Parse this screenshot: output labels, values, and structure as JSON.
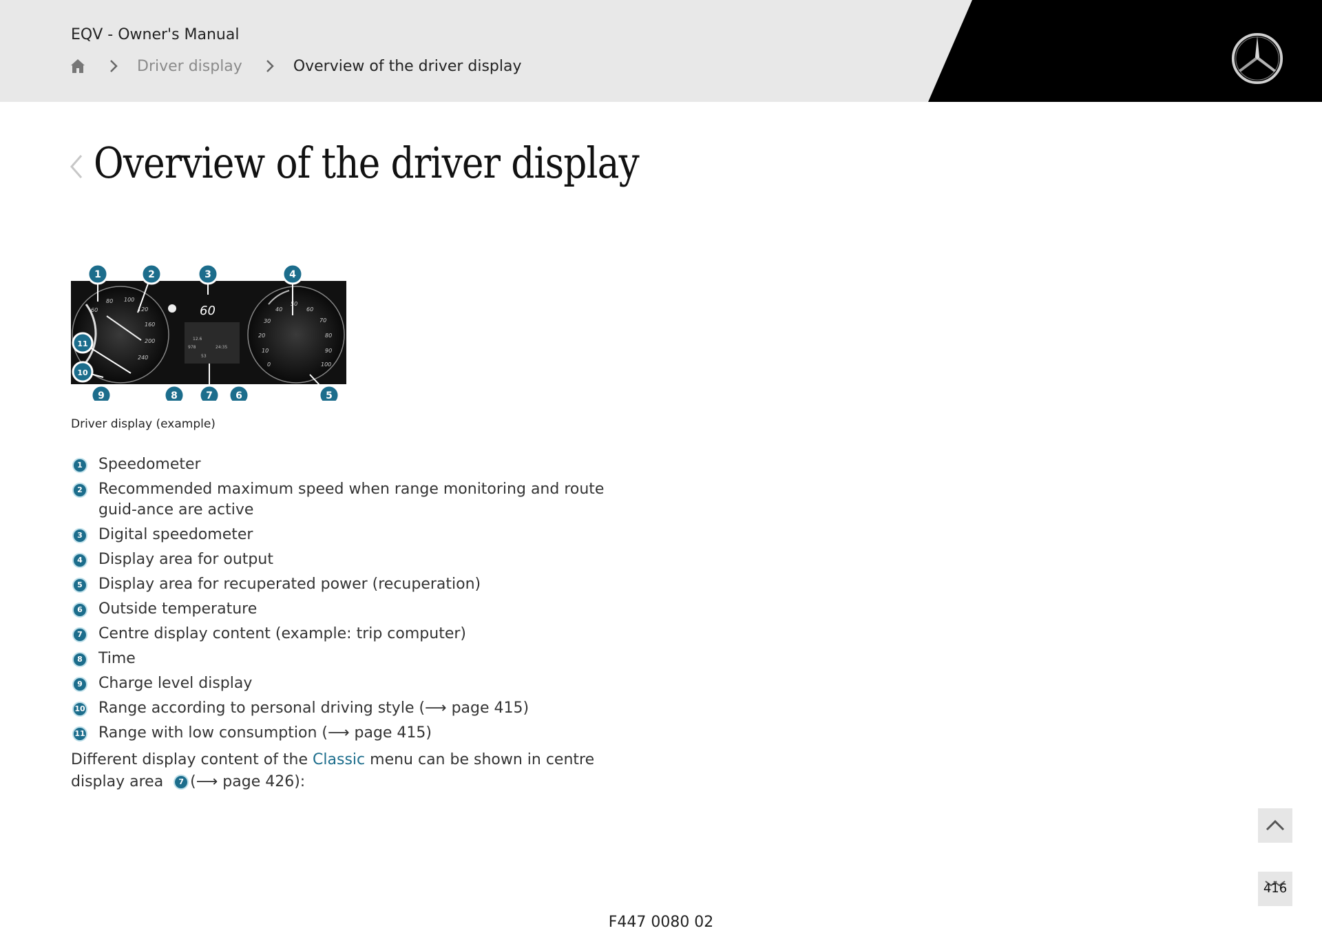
{
  "header": {
    "manual_title": "EQV - Owner's Manual",
    "breadcrumb": {
      "home_icon": "home-icon",
      "separator_icon": "chevron-right-icon",
      "parent": "Driver display",
      "current": "Overview of the driver display"
    },
    "logo": "mercedes-star-logo"
  },
  "page": {
    "back_icon": "chevron-left-icon",
    "title": "Overview of the driver display"
  },
  "figure": {
    "caption": "Driver display (example)",
    "callouts": [
      "1",
      "2",
      "3",
      "4",
      "5",
      "6",
      "7",
      "8",
      "9",
      "10",
      "11"
    ],
    "speed_readout": "60",
    "left_dial_ticks": [
      "60",
      "80",
      "100",
      "120",
      "160",
      "200",
      "240"
    ],
    "right_dial_ticks": [
      "20",
      "30",
      "40",
      "50",
      "60",
      "70",
      "80",
      "90",
      "100",
      "10",
      "0"
    ],
    "center_lines": [
      "12.6",
      "978",
      "24:35",
      "53"
    ]
  },
  "legend": [
    {
      "num": "1",
      "text": "Speedometer"
    },
    {
      "num": "2",
      "text": "Recommended maximum speed when range monitoring and route guid-ance are active"
    },
    {
      "num": "3",
      "text": "Digital speedometer"
    },
    {
      "num": "4",
      "text": "Display area for output"
    },
    {
      "num": "5",
      "text": "Display area for recuperated power (recuperation)"
    },
    {
      "num": "6",
      "text": "Outside temperature"
    },
    {
      "num": "7",
      "text": "Centre display content (example: trip computer)"
    },
    {
      "num": "8",
      "text": "Time"
    },
    {
      "num": "9",
      "text": "Charge level display"
    },
    {
      "num": "10",
      "text": "Range according to personal driving style (⟶ page 415)"
    },
    {
      "num": "11",
      "text": "Range with low consumption (⟶ page 415)"
    }
  ],
  "paragraph": {
    "before_link": "Different display content of the ",
    "link": "Classic",
    "after_link": " menu can be shown in centre display area ",
    "ref_num": "7",
    "after_ref": "(⟶ page 426):"
  },
  "nav": {
    "scroll_top_icon": "chevron-up-icon",
    "page_number": "416"
  },
  "footer": {
    "code": "F447 0080 02"
  },
  "colors": {
    "accent": "#1c6d8c",
    "header_bg": "#e8e8e8",
    "header_black": "#000000"
  }
}
